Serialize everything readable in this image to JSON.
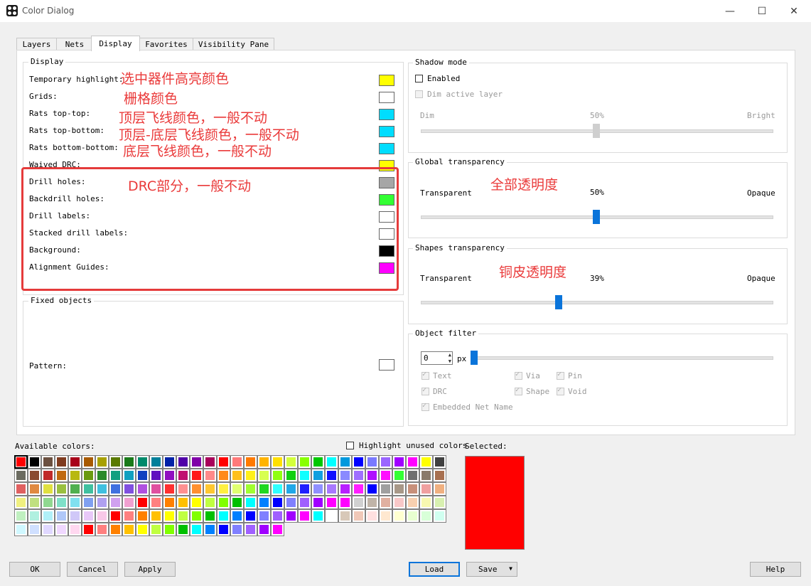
{
  "window": {
    "title": "Color Dialog"
  },
  "tabs": [
    "Layers",
    "Nets",
    "Display",
    "Favorites",
    "Visibility Pane"
  ],
  "display": {
    "title": "Display",
    "rows": [
      {
        "label": "Temporary highlight:",
        "color": "#ffff00"
      },
      {
        "label": "Grids:",
        "color": "#ffffff"
      },
      {
        "label": "Rats top-top:",
        "color": "#00ddff"
      },
      {
        "label": "Rats top-bottom:",
        "color": "#00ddff"
      },
      {
        "label": "Rats bottom-bottom:",
        "color": "#00ddff"
      },
      {
        "label": "Waived DRC:",
        "color": "#ffff00"
      },
      {
        "label": "Drill holes:",
        "color": "#a6a6a6"
      },
      {
        "label": "Backdrill holes:",
        "color": "#33ff33"
      },
      {
        "label": "Drill labels:",
        "color": "#ffffff"
      },
      {
        "label": "Stacked drill labels:",
        "color": "#ffffff"
      },
      {
        "label": "Background:",
        "color": "#000000"
      },
      {
        "label": "Alignment Guides:",
        "color": "#ff00ff"
      }
    ]
  },
  "annotations": {
    "temp_highlight": "选中器件高亮颜色",
    "grids": "栅格颜色",
    "rats_top_top": "顶层飞线颜色，一般不动",
    "rats_top_bottom": "顶层-底层飞线颜色，一般不动",
    "rats_bottom_bottom": "底层飞线颜色，一般不动",
    "drc": "DRC部分，一般不动",
    "global_transparency": "全部透明度",
    "shapes_transparency": "铜皮透明度"
  },
  "fixed_objects": {
    "title": "Fixed objects",
    "pattern_label": "Pattern:",
    "pattern_color": "#ffffff"
  },
  "shadow_mode": {
    "title": "Shadow mode",
    "enabled_label": "Enabled",
    "enabled": false,
    "dim_active_label": "Dim active layer",
    "left": "Dim",
    "mid": "50%",
    "right": "Bright",
    "value": 0.5
  },
  "global_transparency": {
    "title": "Global transparency",
    "left": "Transparent",
    "mid": "50%",
    "right": "Opaque",
    "value": 0.5
  },
  "shapes_transparency": {
    "title": "Shapes transparency",
    "left": "Transparent",
    "mid": "39%",
    "right": "Opaque",
    "value": 0.39
  },
  "object_filter": {
    "title": "Object filter",
    "spin_value": "0",
    "unit": "px",
    "value": 0,
    "checks": {
      "text": "Text",
      "via": "Via",
      "pin": "Pin",
      "drc": "DRC",
      "shape": "Shape",
      "void": "Void",
      "embedded": "Embedded Net Name"
    }
  },
  "palette": {
    "available_label": "Available colors:",
    "highlight_unused_label": "Highlight unused colors",
    "selected_label": "Selected:",
    "selected_color": "#ff0000",
    "rows": [
      [
        "#ff0000",
        "#000000",
        "#6b5040",
        "#7f3b1f",
        "#a80019",
        "#a85a00",
        "#a8a000",
        "#5a7a00",
        "#1a7a1a",
        "#008a6b",
        "#00809a",
        "#0022a8",
        "#5000a8",
        "#8000a8",
        "#a8005a",
        "#ff0000",
        "#ff7a7a",
        "#ff7a00",
        "#ffb400",
        "#ffe000",
        "#d4ff3b",
        "#88ff00",
        "#00c800",
        "#00ffff",
        "#0099dd",
        "#0000ff",
        "#7a7aff",
        "#9a66ff",
        "#a000ff",
        "#ff00ff"
      ],
      [
        "#ffff00",
        "#404040",
        "#6b6b60",
        "#8a4a30",
        "#c02a2a",
        "#c06a10",
        "#b8b810",
        "#6a9a10",
        "#2a8a2a",
        "#10a080",
        "#10a0c0",
        "#1040c0",
        "#6010c0",
        "#9010c0",
        "#c01070",
        "#ff1a1a",
        "#ff8a8a",
        "#ff8a1a",
        "#ffc01a",
        "#fff01a",
        "#d8ff50",
        "#90ff10",
        "#10d010",
        "#10ffff",
        "#10a0e0",
        "#1010ff",
        "#8a8aff",
        "#a070ff",
        "#b010ff",
        "#ff10ff"
      ],
      [
        "#33ff33",
        "#707070",
        "#8a7a6a",
        "#a87050",
        "#e06060",
        "#e08a40",
        "#e0e040",
        "#9ac040",
        "#50b050",
        "#40c0a0",
        "#40c0e0",
        "#4070e0",
        "#8050e0",
        "#b050e0",
        "#e050a0",
        "#ff3030",
        "#ff9090",
        "#ff9030",
        "#ffc830",
        "#fff040",
        "#e0ff70",
        "#a0ff30",
        "#20d820",
        "#30ffff",
        "#20a8e8",
        "#2020ff",
        "#9090ff",
        "#a878ff",
        "#b820ff",
        "#ff20ff"
      ],
      [
        "#0000ff",
        "#a0a0a0",
        "#a89888",
        "#c8907a",
        "#f0a0a0",
        "#f0b080",
        "#f0f080",
        "#c0e080",
        "#90d890",
        "#80e0c8",
        "#80e0f0",
        "#80a0f0",
        "#b0a0f0",
        "#d0a0f0",
        "#f0a0d0",
        "#ff0000",
        "#ff8080",
        "#ff8000",
        "#ffc000",
        "#ffff00",
        "#c0ff40",
        "#80ff00",
        "#00c000",
        "#00ffff",
        "#0080ff",
        "#0000ff",
        "#8080ff",
        "#a060ff",
        "#a000ff",
        "#ff00ff"
      ],
      [
        "#ff00ff",
        "#d0d0d0",
        "#c0b4a8",
        "#e0b0a0",
        "#f8c8c8",
        "#f8d0b0",
        "#f8f8b0",
        "#d8f0b0",
        "#c0f0c0",
        "#b0f0e0",
        "#b0f0f8",
        "#b0c8f8",
        "#d0c8f8",
        "#e8c8f8",
        "#f8c8e8",
        "#ff0000",
        "#ff8080",
        "#ff8000",
        "#ffc000",
        "#ffff00",
        "#c0ff40",
        "#80ff00",
        "#00c000",
        "#00ffff",
        "#0080ff",
        "#0000ff",
        "#8080ff",
        "#a060ff",
        "#a000ff",
        "#ff00ff"
      ],
      [
        "#00ffff",
        "#ffffff",
        "#d8c8b8",
        "#f0c8b8",
        "#ffe0e0",
        "#ffe8d0",
        "#ffffd0",
        "#e8ffd0",
        "#d8ffd8",
        "#d0fff0",
        "#d0f8ff",
        "#d0e0ff",
        "#e0d8ff",
        "#f0d8ff",
        "#ffd8f0",
        "#ff0000",
        "#ff8080",
        "#ff8000",
        "#ffc000",
        "#ffff00",
        "#c0ff40",
        "#80ff00",
        "#00c000",
        "#00ffff",
        "#0080ff",
        "#0000ff",
        "#8080ff",
        "#a060ff",
        "#a000ff",
        "#ff00ff"
      ]
    ]
  },
  "buttons": {
    "ok": "OK",
    "cancel": "Cancel",
    "apply": "Apply",
    "load": "Load",
    "save": "Save",
    "help": "Help"
  }
}
